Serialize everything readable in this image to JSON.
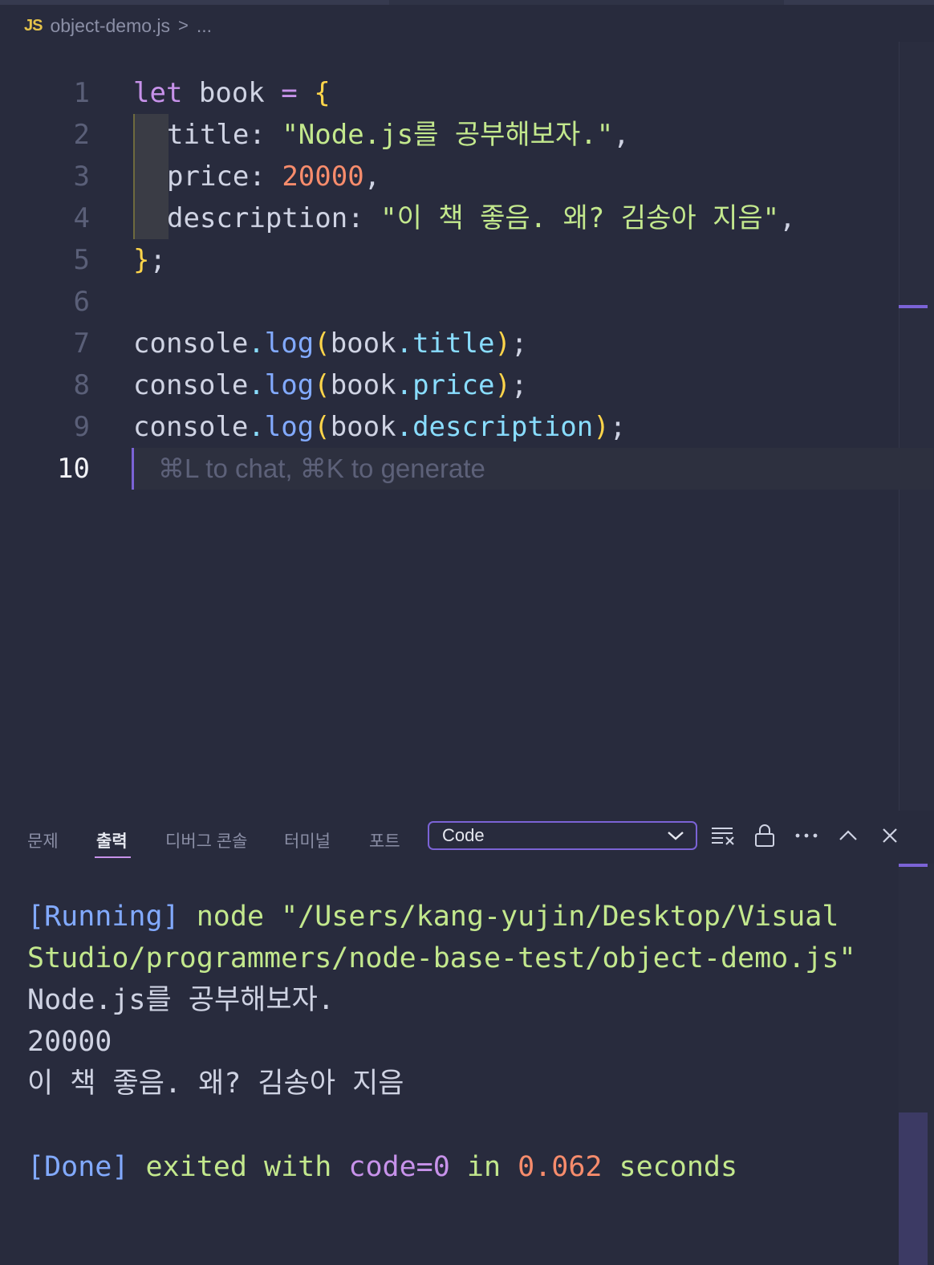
{
  "breadcrumb": {
    "file_badge": "JS",
    "file_name": "object-demo.js",
    "separator": ">",
    "more": "..."
  },
  "editor": {
    "line_numbers": [
      "1",
      "2",
      "3",
      "4",
      "5",
      "6",
      "7",
      "8",
      "9",
      "10"
    ],
    "active_line": "10",
    "lines": [
      {
        "t1": "let",
        "t2": " book ",
        "t3": "=",
        "t4": " ",
        "t5": "{"
      },
      {
        "key": "title",
        "colon": ": ",
        "str": "\"Node.js를 공부해보자.\"",
        "end": ","
      },
      {
        "key": "price",
        "colon": ": ",
        "num": "20000",
        "end": ","
      },
      {
        "key": "description",
        "colon": ": ",
        "str": "\"이 책 좋음. 왜? 김송아 지음\"",
        "end": ","
      },
      {
        "br": "}",
        "end": ";"
      },
      {},
      {
        "obj": "console",
        "dot": ".",
        "fn": "log",
        "open": "(",
        "arg_obj": "book",
        "dot2": ".",
        "prop": "title",
        "close": ")",
        "end": ";"
      },
      {
        "obj": "console",
        "dot": ".",
        "fn": "log",
        "open": "(",
        "arg_obj": "book",
        "dot2": ".",
        "prop": "price",
        "close": ")",
        "end": ";"
      },
      {
        "obj": "console",
        "dot": ".",
        "fn": "log",
        "open": "(",
        "arg_obj": "book",
        "dot2": ".",
        "prop": "description",
        "close": ")",
        "end": ";"
      }
    ],
    "hint": "⌘L to chat, ⌘K to generate"
  },
  "panel": {
    "tabs": [
      {
        "label": "문제",
        "active": false
      },
      {
        "label": "출력",
        "active": true
      },
      {
        "label": "디버그 콘솔",
        "active": false
      },
      {
        "label": "터미널",
        "active": false
      },
      {
        "label": "포트",
        "active": false
      }
    ],
    "select_value": "Code",
    "icons": [
      "clear-output-icon",
      "lock-icon",
      "more-icon",
      "chevron-up-icon",
      "close-icon"
    ],
    "output": {
      "running_tag": "[Running]",
      "running_cmd_1": " node \"/Users/kang-yujin/Desktop/Visual",
      "running_cmd_2": "Studio/programmers/node-base-test/object-demo.js\"",
      "log_1": "Node.js를 공부해보자.",
      "log_2": "20000",
      "log_3": "이 책 좋음. 왜? 김송아 지음",
      "done_tag": "[Done]",
      "done_text": " exited with ",
      "done_code": "code=0",
      "done_in": " in ",
      "done_time": "0.062",
      "done_seconds": " seconds"
    }
  },
  "colors": {
    "background": "#282b3d",
    "accent": "#7b63d6",
    "string": "#c3e88d",
    "number": "#f78c6c",
    "keyword": "#c792ea",
    "function": "#82aaff"
  }
}
